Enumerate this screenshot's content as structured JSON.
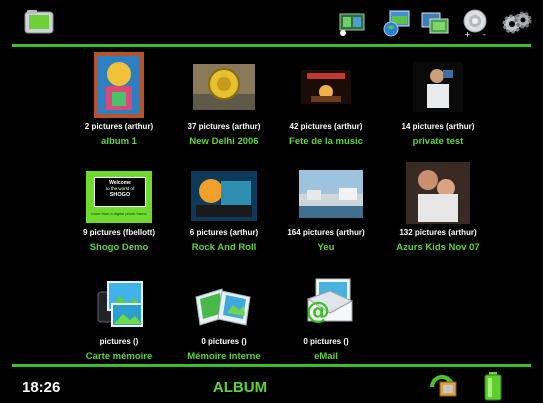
{
  "header": {
    "icons": [
      "album-folder-icon",
      "slideshow-icon",
      "globe-photo-icon",
      "transfer-icon",
      "volume-icon",
      "settings-icon"
    ]
  },
  "albums": [
    {
      "count": "2 pictures (arthur)",
      "name": "album 1"
    },
    {
      "count": "37 pictures (arthur)",
      "name": "New Delhi 2006"
    },
    {
      "count": "42 pictures (arthur)",
      "name": "Fete de la music"
    },
    {
      "count": "14 pictures (arthur)",
      "name": "private test"
    },
    {
      "count": "9 pictures (fbellott)",
      "name": "Shogo Demo",
      "thumb_text": [
        "Welcome",
        "to the world of",
        "SHOGO",
        "more than a digital photo frame"
      ]
    },
    {
      "count": "6 pictures (arthur)",
      "name": "Rock And Roll"
    },
    {
      "count": "164 pictures (arthur)",
      "name": "Yeu"
    },
    {
      "count": "132 pictures (arthur)",
      "name": "Azurs Kids Nov 07"
    },
    {
      "count": "pictures ()",
      "name": "Carte mémoire"
    },
    {
      "count": "0 pictures ()",
      "name": "Mémoire interne"
    },
    {
      "count": "0 pictures ()",
      "name": "eMail"
    }
  ],
  "footer": {
    "time": "18:26",
    "title": "ALBUM",
    "icons": [
      "sync-icon",
      "battery-icon"
    ]
  },
  "colors": {
    "accent": "#5fd43a",
    "line": "#3bbf2a",
    "background": "#000000"
  }
}
